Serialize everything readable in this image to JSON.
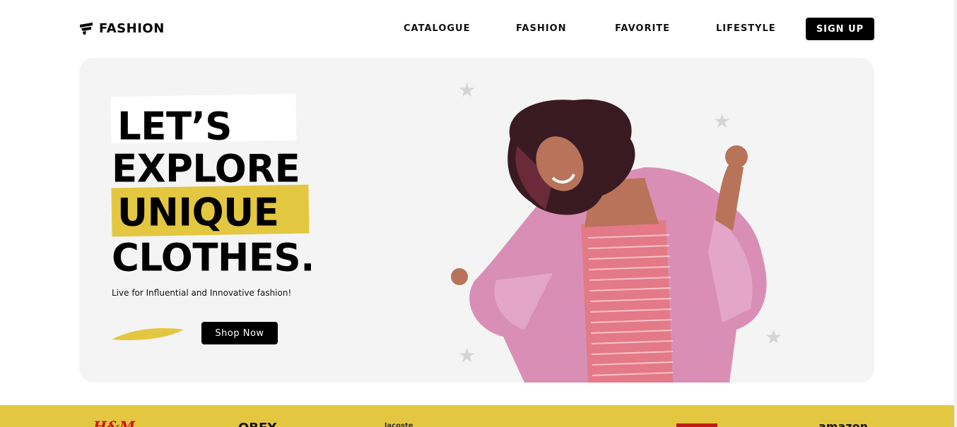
{
  "header": {
    "logo_text": "FASHION",
    "logo_icon": "fashion-logo-icon",
    "nav": [
      {
        "label": "CATALOGUE"
      },
      {
        "label": "FASHION"
      },
      {
        "label": "FAVORITE"
      },
      {
        "label": "LIFESTYLE"
      }
    ],
    "signup_label": "SIGN UP"
  },
  "hero": {
    "headline": [
      "LET’S",
      "EXPLORE",
      "UNIQUE",
      "CLOTHES."
    ],
    "tagline": "Live for Influential and Innovative fashion!",
    "cta_label": "Shop Now",
    "image_alt": "Woman with curly hair in pink fluffy coat dancing",
    "decor_icon": "star-icon"
  },
  "brands": {
    "items": [
      "H&M",
      "OBEY",
      "lacoste",
      "levis",
      "amazon"
    ]
  },
  "colors": {
    "accent": "#e4c740",
    "panel": "#f3f4f3",
    "button": "#000000",
    "button_text": "#ffffff"
  }
}
